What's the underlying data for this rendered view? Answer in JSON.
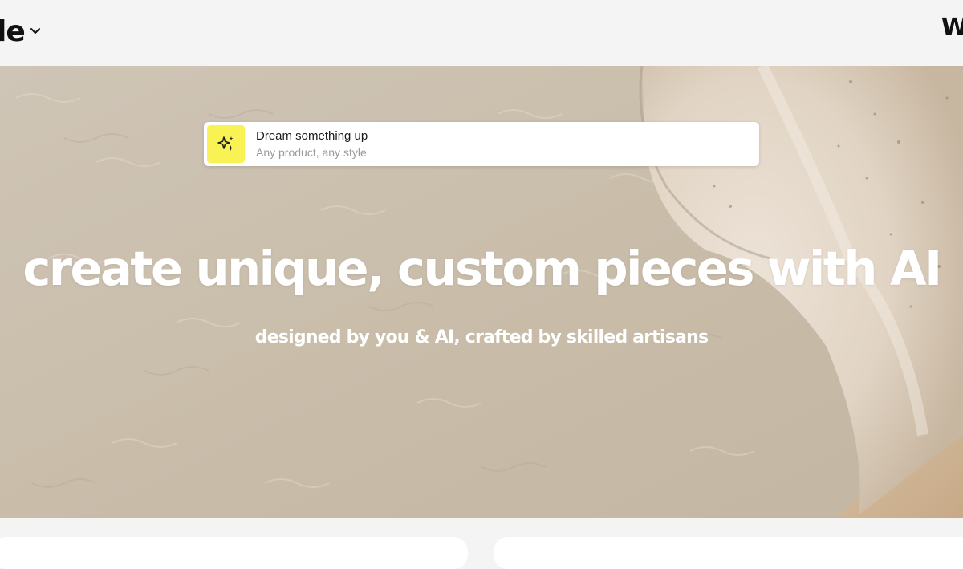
{
  "header": {
    "logo_text": "le",
    "logo_caret_icon": "chevron-down-icon",
    "right_edge_text": "W"
  },
  "prompt": {
    "title": "Dream something up",
    "placeholder": "Any product, any style",
    "icon": "sparkles-icon",
    "icon_bg": "#f8f255"
  },
  "hero": {
    "title": "create unique, custom pieces with AI",
    "subtitle": "designed by you & AI, crafted by skilled artisans"
  },
  "colors": {
    "page_bg": "#f4f4f4",
    "hero_text": "#ffffff"
  }
}
